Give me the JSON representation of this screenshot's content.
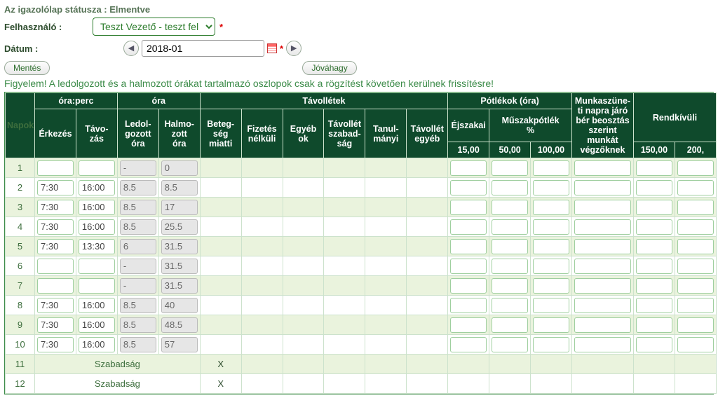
{
  "status_line": "Az igazolólap státusza : Elmentve",
  "labels": {
    "user": "Felhasználó :",
    "date": "Dátum :"
  },
  "user_select": "Teszt Vezető - teszt felha",
  "date_value": "2018-01",
  "buttons": {
    "save": "Mentés",
    "approve": "Jóváhagy",
    "prev": "◀",
    "next": "▶"
  },
  "warning": "Figyelem! A ledolgozott és a halmozott órákat tartalmazó oszlopok csak a rögzítést követően kerülnek frissítésre!",
  "headers": {
    "oraperc": "óra:perc",
    "ora": "óra",
    "tavolletek": "Távollétek",
    "potlekok": "Pótlékok (óra)",
    "napok": "Napok",
    "erkezes": "Érkezés",
    "tavozas": "Távo-\nzás",
    "ledolgozott": "Ledol-\ngozott\nóra",
    "halmozott": "Halmo-\nzott\nóra",
    "beteg": "Beteg-\nség\nmiatti",
    "fiz": "Fizetés\nnélküli",
    "egyeb": "Egyéb\nok",
    "tavszab": "Távollét\nszabad-\nság",
    "tanul": "Tanul-\nmányi",
    "tavegyeb": "Távollét\negyéb",
    "ejszakai": "Éjszakai",
    "muszak": "Műszakpótlék\n%",
    "ejs15": "15,00",
    "musz50": "50,00",
    "musz100": "100,00",
    "munkaszunet": "Munkaszüne-\nti napra járó\nbér beosztás\nszerint\nmunkát\nvégzőknek",
    "rendkivuli": "Rendkívüli",
    "r150": "150,00",
    "r200": "200,"
  },
  "rows": [
    {
      "day": 1,
      "erk": "",
      "tav": "",
      "ledol": "-",
      "halm": "0"
    },
    {
      "day": 2,
      "erk": "7:30",
      "tav": "16:00",
      "ledol": "8.5",
      "halm": "8.5"
    },
    {
      "day": 3,
      "erk": "7:30",
      "tav": "16:00",
      "ledol": "8.5",
      "halm": "17"
    },
    {
      "day": 4,
      "erk": "7:30",
      "tav": "16:00",
      "ledol": "8.5",
      "halm": "25.5"
    },
    {
      "day": 5,
      "erk": "7:30",
      "tav": "13:30",
      "ledol": "6",
      "halm": "31.5"
    },
    {
      "day": 6,
      "erk": "",
      "tav": "",
      "ledol": "-",
      "halm": "31.5"
    },
    {
      "day": 7,
      "erk": "",
      "tav": "",
      "ledol": "-",
      "halm": "31.5"
    },
    {
      "day": 8,
      "erk": "7:30",
      "tav": "16:00",
      "ledol": "8.5",
      "halm": "40"
    },
    {
      "day": 9,
      "erk": "7:30",
      "tav": "16:00",
      "ledol": "8.5",
      "halm": "48.5"
    },
    {
      "day": 10,
      "erk": "7:30",
      "tav": "16:00",
      "ledol": "8.5",
      "halm": "57"
    },
    {
      "day": 11,
      "szabadsag": true,
      "beteg": "X"
    },
    {
      "day": 12,
      "szabadsag": true,
      "beteg": "X"
    }
  ],
  "szabadsag_label": "Szabadság"
}
